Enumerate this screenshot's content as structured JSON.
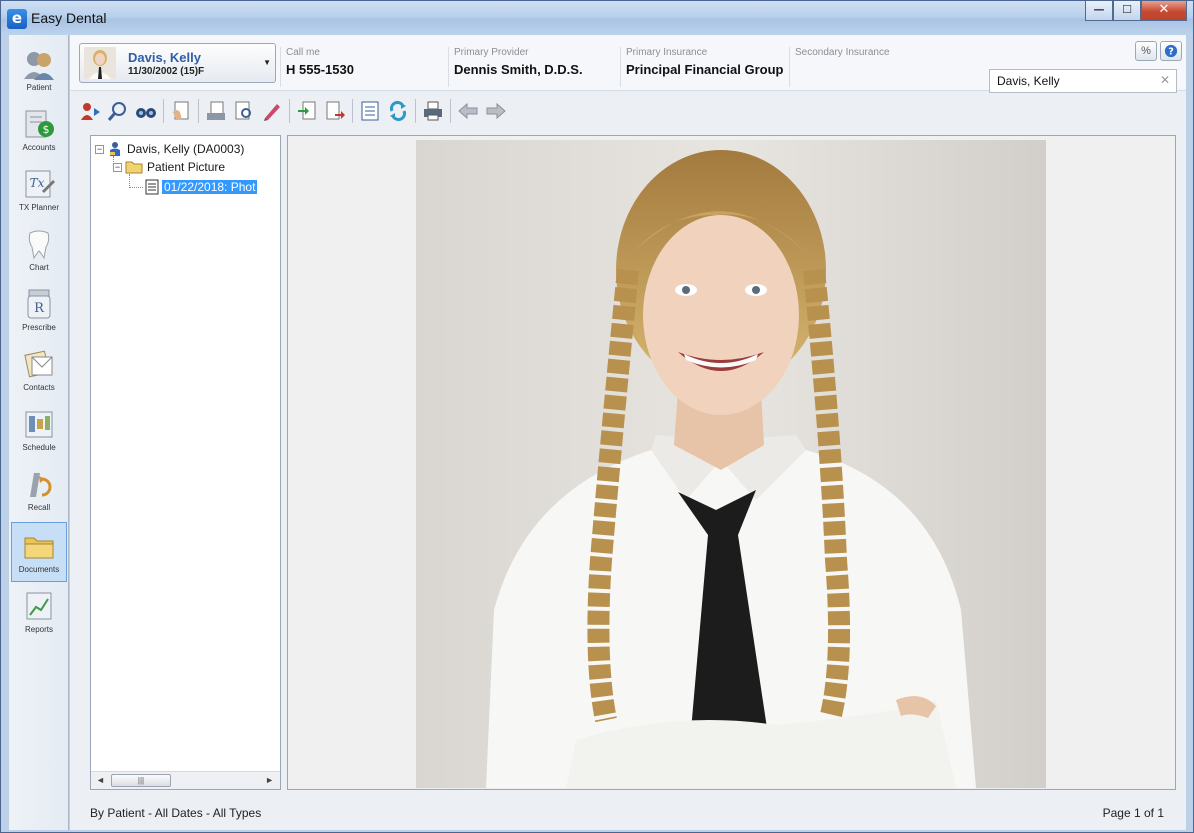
{
  "window": {
    "title": "Easy Dental",
    "app_icon_letter": "e",
    "controls": {
      "minimize": "—",
      "maximize": "☐",
      "close": "✕"
    }
  },
  "nav": {
    "items": [
      {
        "label": "Patient",
        "icon": "patient-icon"
      },
      {
        "label": "Accounts",
        "icon": "accounts-icon"
      },
      {
        "label": "TX Planner",
        "icon": "tx-planner-icon"
      },
      {
        "label": "Chart",
        "icon": "tooth-chart-icon"
      },
      {
        "label": "Prescribe",
        "icon": "prescription-icon"
      },
      {
        "label": "Contacts",
        "icon": "contacts-icon"
      },
      {
        "label": "Schedule",
        "icon": "schedule-icon"
      },
      {
        "label": "Recall",
        "icon": "recall-icon"
      },
      {
        "label": "Documents",
        "icon": "folder-icon",
        "active": true
      },
      {
        "label": "Reports",
        "icon": "reports-icon"
      }
    ]
  },
  "patient": {
    "name": "Davis, Kelly",
    "dob_line": "11/30/2002 (15)F"
  },
  "header": {
    "call_me": {
      "caption": "Call me",
      "value": "H 555-1530"
    },
    "primary_provider": {
      "caption": "Primary Provider",
      "value": "Dennis Smith, D.D.S."
    },
    "primary_insurance": {
      "caption": "Primary Insurance",
      "value": "Principal Financial Group"
    },
    "secondary_insurance": {
      "caption": "Secondary Insurance",
      "value": ""
    },
    "search": {
      "value": "Davis, Kelly"
    }
  },
  "tree": {
    "root": "Davis, Kelly (DA0003)",
    "folder": "Patient Picture",
    "document": "01/22/2018: Phot"
  },
  "footer": {
    "filter": "By Patient - All Dates - All Types",
    "page": "Page 1 of 1"
  },
  "colors": {
    "accent": "#2e5ea8",
    "selection": "#3399ff",
    "titlebar": "#b9d0ec"
  }
}
